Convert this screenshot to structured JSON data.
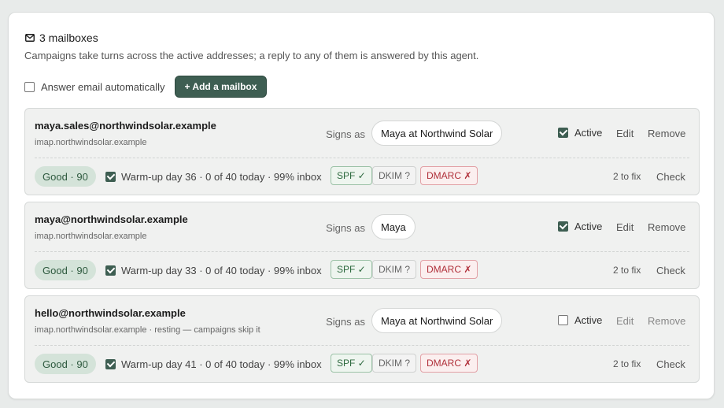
{
  "header": {
    "icon": "mail-icon",
    "title": "3 mailboxes",
    "subtitle": "Campaigns take turns across the active addresses; a reply to any of them is answered by this agent."
  },
  "controls": {
    "auto_answer_label": "Answer email automatically",
    "auto_answer_checked": false,
    "add_button_label": "+ Add a mailbox"
  },
  "labels": {
    "signs_as": "Signs as",
    "active": "Active",
    "edit": "Edit",
    "remove": "Remove",
    "check": "Check"
  },
  "colors": {
    "accent": "#3e5e52",
    "good_bg": "#d4e3d9",
    "spf_ok": "#2e6a3f",
    "dmarc_fail": "#b0303a"
  },
  "mailboxes": [
    {
      "email": "maya.sales@northwindsolar.example",
      "host": "imap.northwindsolar.example",
      "signature": "Maya at Northwind Solar",
      "active": true,
      "health": "Good · 90",
      "warmup_checked": true,
      "warmup": "Warm-up day 36 · 0 of 40 today · 99% inbox",
      "spf": "SPF ✓",
      "dkim": "DKIM ?",
      "dmarc": "DMARC ✗",
      "to_fix": "2 to fix"
    },
    {
      "email": "maya@northwindsolar.example",
      "host": "imap.northwindsolar.example",
      "signature": "Maya",
      "active": true,
      "health": "Good · 90",
      "warmup_checked": true,
      "warmup": "Warm-up day 33 · 0 of 40 today · 99% inbox",
      "spf": "SPF ✓",
      "dkim": "DKIM ?",
      "dmarc": "DMARC ✗",
      "to_fix": "2 to fix"
    },
    {
      "email": "hello@northwindsolar.example",
      "host": "imap.northwindsolar.example · resting — campaigns skip it",
      "signature": "Maya at Northwind Solar",
      "active": false,
      "health": "Good · 90",
      "warmup_checked": true,
      "warmup": "Warm-up day 41 · 0 of 40 today · 99% inbox",
      "spf": "SPF ✓",
      "dkim": "DKIM ?",
      "dmarc": "DMARC ✗",
      "to_fix": "2 to fix"
    }
  ]
}
